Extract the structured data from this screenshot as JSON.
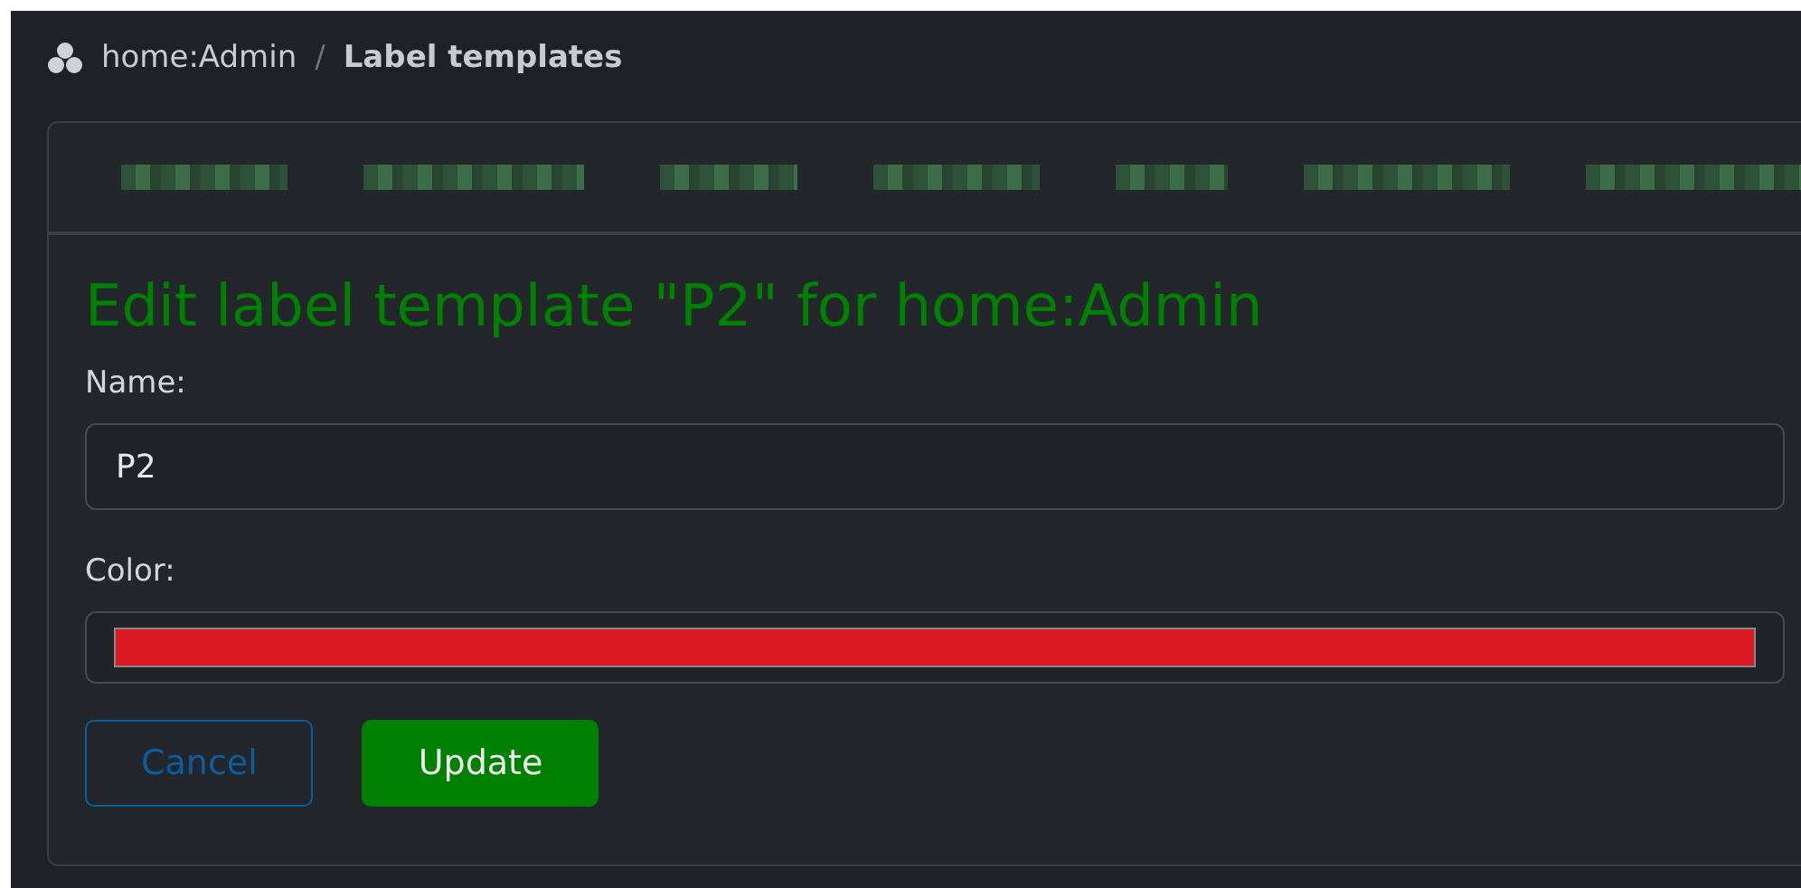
{
  "breadcrumb": {
    "project": "home:Admin",
    "separator": "/",
    "current": "Label templates"
  },
  "heading": "Edit label template \"P2\" for home:Admin",
  "fields": [
    {
      "kind": "text",
      "label": "Name:",
      "value": "P2"
    },
    {
      "kind": "color",
      "label": "Color:",
      "color": "#dc1a24"
    }
  ],
  "buttons": [
    {
      "kind": "outline",
      "label": "Cancel"
    },
    {
      "kind": "primary",
      "label": "Update"
    }
  ]
}
